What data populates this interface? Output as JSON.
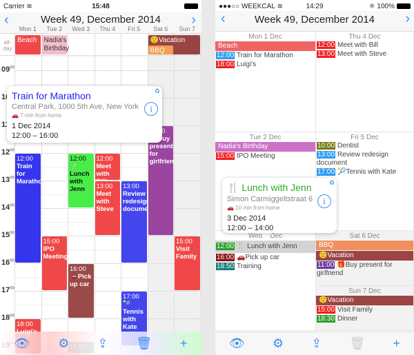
{
  "left": {
    "status": {
      "carrier": "Carrier",
      "time": "15:48"
    },
    "title": "Week 49, December 2014",
    "days": [
      "Mon 1",
      "Tue 2",
      "Wed 3",
      "Thu 4",
      "Fri 5",
      "Sat 6",
      "Sun 7"
    ],
    "allday_label": "all-day",
    "hours": [
      "09",
      "10",
      "11",
      "12",
      "13",
      "14",
      "15",
      "16",
      "17",
      "18",
      "19"
    ],
    "allday": [
      {
        "day": 0,
        "span": 1,
        "row": 0,
        "title": "Beach",
        "color": "#f04848",
        "text": "#fff"
      },
      {
        "day": 1,
        "span": 1,
        "row": 0,
        "title": "Nadia's Birthday",
        "color": "#f4bccb",
        "text": "#333"
      },
      {
        "day": 5,
        "span": 2,
        "row": 0,
        "title": "🙂Vacation",
        "color": "#984444",
        "text": "#fff"
      },
      {
        "day": 5,
        "span": 1,
        "row": 1,
        "title": "BBQ",
        "color": "#f0a050",
        "text": "#fff"
      }
    ],
    "events": [
      {
        "day": 0,
        "start": 12,
        "end": 16,
        "time": "12:00",
        "title": "Train for Marathon",
        "color": "#3535ee",
        "text": "#fff"
      },
      {
        "day": 0,
        "start": 18,
        "end": 19.5,
        "time": "18:00",
        "title": "Luigi's",
        "color": "#f04848",
        "text": "#fff"
      },
      {
        "day": 1,
        "start": 15,
        "end": 17,
        "time": "15:00",
        "title": "IPO Meeting",
        "color": "#f04848",
        "text": "#fff"
      },
      {
        "day": 2,
        "start": 12,
        "end": 14,
        "time": "12:00",
        "title": "🍴 Lunch with Jenn",
        "color": "#48ee48",
        "text": "#111"
      },
      {
        "day": 2,
        "start": 16,
        "end": 18,
        "time": "16:00",
        "title": "🚗Pick up car",
        "color": "#9a4a48",
        "text": "#fff"
      },
      {
        "day": 2,
        "start": 18.83,
        "end": 20,
        "time": "18:50",
        "title": "Training",
        "color": "#66aaaa",
        "text": "#fff"
      },
      {
        "day": 3,
        "start": 12,
        "end": 13,
        "time": "12:00",
        "title": "Meet with Bill",
        "color": "#f04848",
        "text": "#fff"
      },
      {
        "day": 3,
        "start": 13,
        "end": 15,
        "time": "13:00",
        "title": "Meet with Steve",
        "color": "#f04848",
        "text": "#fff"
      },
      {
        "day": 4,
        "start": 13,
        "end": 16,
        "time": "13:00",
        "title": "Review redesign document",
        "color": "#4545ee",
        "text": "#fff"
      },
      {
        "day": 4,
        "start": 17,
        "end": 19,
        "time": "17:00",
        "title": "🎾 Tennis with Kate",
        "color": "#4545ee",
        "text": "#fff"
      },
      {
        "day": 5,
        "start": 11,
        "end": 15,
        "time": "11:00",
        "title": "🎁Buy present for girlfriend",
        "color": "#9b44a0",
        "text": "#fff"
      },
      {
        "day": 6,
        "start": 15,
        "end": 17,
        "time": "15:00",
        "title": "Visit Family",
        "color": "#f04848",
        "text": "#fff"
      }
    ],
    "popover": {
      "title": "Train for Marathon",
      "location": "Central Park, 1000 5th Ave, New York",
      "travel": "7 min from home",
      "date": "1 Dec 2014",
      "time": "12:00 – 16:00",
      "title_color": "#2222ee"
    }
  },
  "right": {
    "status": {
      "carrier": "●●●○○ WEEKCAL",
      "time": "14:29",
      "battery": "100%"
    },
    "title": "Week 49, December 2014",
    "days": [
      {
        "name": "Mon 1 Dec",
        "bars": [
          {
            "title": "Beach",
            "color": "#f06464"
          }
        ],
        "items": [
          {
            "time": "12:00",
            "title": "Train for Marathon",
            "color": "#2f9cf0"
          },
          {
            "time": "18:00",
            "title": "Luigi's",
            "color": "#f02020"
          }
        ]
      },
      {
        "name": "Tue 2 Dec",
        "bars": [
          {
            "title": "Nadia's Birthday",
            "color": "#cc70c8"
          }
        ],
        "items": [
          {
            "time": "15:00",
            "title": "IPO Meeting",
            "color": "#f02020"
          }
        ]
      },
      {
        "name": "Wed 3 Dec",
        "bars": [],
        "items": [
          {
            "time": "12:00",
            "title": "🍴 Lunch with Jenn",
            "color": "#2aa02a",
            "selected": true
          },
          {
            "time": "16:00",
            "title": "🚗Pick up car",
            "color": "#8a1010"
          },
          {
            "time": "18:50",
            "title": "Training",
            "color": "#1a7a7a"
          }
        ]
      },
      {
        "name": "Thu 4 Dec",
        "bars": [],
        "items": [
          {
            "time": "12:00",
            "title": "Meet with Bill",
            "color": "#f02020"
          },
          {
            "time": "13:00",
            "title": "Meet with Steve",
            "color": "#f02020"
          }
        ]
      },
      {
        "name": "Fri 5 Dec",
        "bars": [],
        "items": [
          {
            "time": "10:00",
            "title": "Dentist",
            "color": "#7a7a10"
          },
          {
            "time": "13:00",
            "title": "Review redesign document",
            "color": "#2f9cf0"
          },
          {
            "time": "17:00",
            "title": "🎾Tennis with Kate",
            "color": "#2f9cf0"
          }
        ]
      },
      {
        "name": "Sat 6 Dec",
        "bars": [
          {
            "title": "BBQ",
            "color": "#f09060"
          },
          {
            "title": "🙂Vacation",
            "color": "#9a4444"
          }
        ],
        "items": [
          {
            "time": "11:00",
            "title": "🎁Buy present for girlfriend",
            "color": "#6a3aa0"
          }
        ]
      },
      {
        "name": "Sun 7 Dec",
        "bars": [
          {
            "title": "🙂Vacation",
            "color": "#9a4444"
          }
        ],
        "items": [
          {
            "time": "15:00",
            "title": "Visit Family",
            "color": "#f02020"
          },
          {
            "time": "18:30",
            "title": "Dinner",
            "color": "#2aa02a"
          }
        ]
      }
    ],
    "popover": {
      "title": "🍴 Lunch with Jenn",
      "location": "Simon Carmiggeltstraat 6",
      "travel": "10 min from home",
      "date": "3 Dec 2014",
      "time": "12:00 – 14:00",
      "title_color": "#2aaa2a"
    }
  },
  "toolbar": {
    "icons": [
      "eye-icon",
      "gear-icon",
      "share-icon",
      "trash-icon",
      "plus-icon"
    ]
  },
  "accent": "#3d8ef0"
}
